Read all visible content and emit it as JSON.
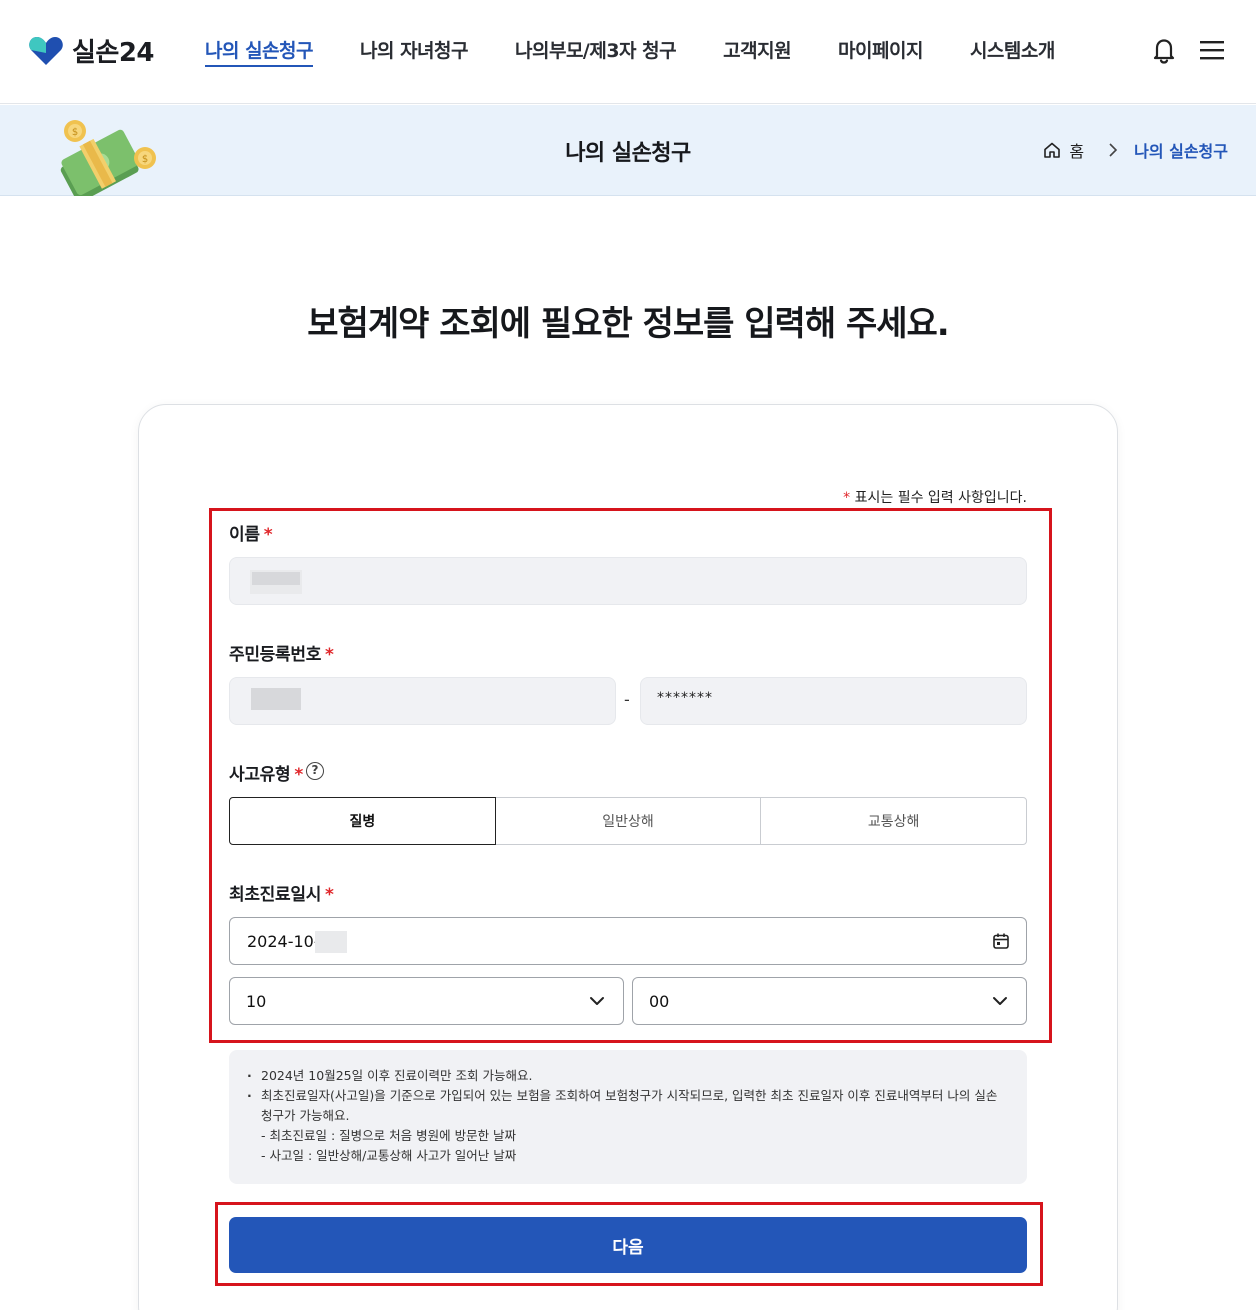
{
  "header": {
    "logo_text": "실손24",
    "nav": [
      {
        "label": "나의 실손청구",
        "active": true
      },
      {
        "label": "나의 자녀청구"
      },
      {
        "label": "나의부모/제3자 청구"
      },
      {
        "label": "고객지원"
      },
      {
        "label": "마이페이지"
      },
      {
        "label": "시스템소개"
      }
    ],
    "icons": [
      "bell-icon",
      "menu-icon"
    ]
  },
  "banner": {
    "title": "나의 실손청구",
    "breadcrumb": {
      "home": "홈",
      "current": "나의 실손청구"
    }
  },
  "page": {
    "heading": "보험계약 조회에 필요한 정보를 입력해 주세요."
  },
  "form": {
    "required_star": "*",
    "required_note": "표시는 필수 입력 사항입니다.",
    "name_label": "이름",
    "rrn_label": "주민등록번호",
    "rrn_dash": "-",
    "rrn_back_value": "*******",
    "accident_label": "사고유형",
    "help_glyph": "?",
    "accident_types": [
      {
        "label": "질병",
        "selected": true
      },
      {
        "label": "일반상해",
        "selected": false
      },
      {
        "label": "교통상해",
        "selected": false
      }
    ],
    "first_visit_label": "최초진료일시",
    "date_value": "2024-10-",
    "hour_value": "10",
    "minute_value": "00"
  },
  "info": {
    "line1": "2024년 10월25일 이후 진료이력만 조회 가능해요.",
    "line2": "최초진료일자(사고일)을 기준으로 가입되어 있는 보험을 조회하여 보험청구가 시작되므로, 입력한 최초 진료일자 이후 진료내역부터 나의 실손청구가 가능해요.",
    "line3": "- 최초진료일 : 질병으로 처음 병원에 방문한 날짜",
    "line4": "- 사고일 : 일반상해/교통상해 사고가 일어난 날짜"
  },
  "next_button": "다음",
  "colors": {
    "accent": "#2356b8",
    "highlight": "#d6141c",
    "required": "#e0262a"
  }
}
